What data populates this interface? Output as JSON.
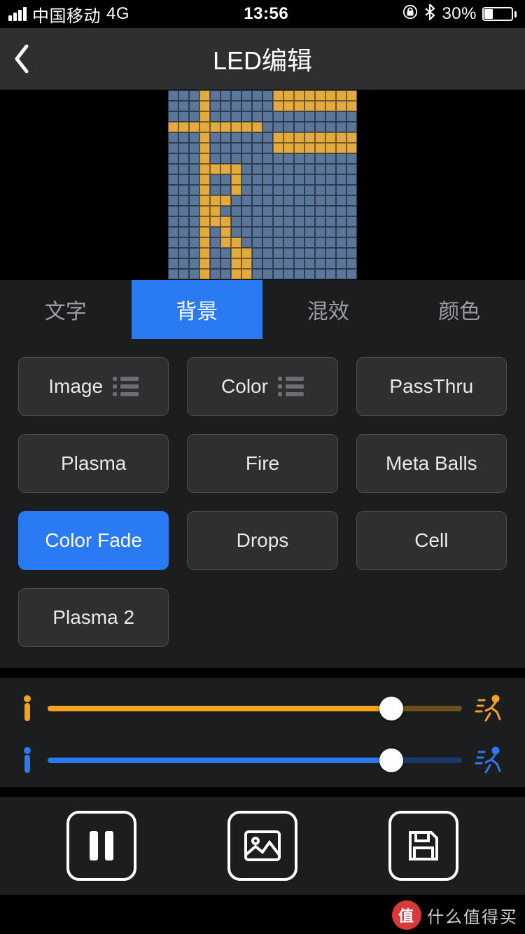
{
  "status": {
    "carrier": "中国移动",
    "network": "4G",
    "time": "13:56",
    "battery_pct": "30%",
    "lock_icon": "orientation-lock",
    "bluetooth_icon": "bluetooth"
  },
  "header": {
    "title": "LED编辑"
  },
  "tabs": [
    {
      "label": "文字",
      "active": false
    },
    {
      "label": "背景",
      "active": true
    },
    {
      "label": "混效",
      "active": false
    },
    {
      "label": "颜色",
      "active": false
    }
  ],
  "effects": [
    {
      "label": "Image",
      "has_list_icon": true,
      "selected": false
    },
    {
      "label": "Color",
      "has_list_icon": true,
      "selected": false
    },
    {
      "label": "PassThru",
      "has_list_icon": false,
      "selected": false
    },
    {
      "label": "Plasma",
      "has_list_icon": false,
      "selected": false
    },
    {
      "label": "Fire",
      "has_list_icon": false,
      "selected": false
    },
    {
      "label": "Meta Balls",
      "has_list_icon": false,
      "selected": false
    },
    {
      "label": "Color Fade",
      "has_list_icon": false,
      "selected": true
    },
    {
      "label": "Drops",
      "has_list_icon": false,
      "selected": false
    },
    {
      "label": "Cell",
      "has_list_icon": false,
      "selected": false
    },
    {
      "label": "Plasma 2",
      "has_list_icon": false,
      "selected": false
    }
  ],
  "sliders": {
    "speed": {
      "color": "#f4a320",
      "value_pct": 83
    },
    "intensity": {
      "color": "#2a7af4",
      "value_pct": 83
    }
  },
  "actions": {
    "pause": "pause",
    "gallery": "image-gallery",
    "save": "save"
  },
  "watermark": {
    "badge": "值",
    "text": "什么值得买"
  },
  "led_preview": {
    "cols": 18,
    "rows": 18,
    "on_cells": [
      "0,3",
      "1,3",
      "2,3",
      "3,3",
      "4,3",
      "5,3",
      "6,3",
      "7,3",
      "8,3",
      "9,3",
      "10,3",
      "11,3",
      "12,3",
      "13,3",
      "14,3",
      "15,3",
      "16,3",
      "17,3",
      "0,10",
      "0,11",
      "0,12",
      "0,13",
      "0,14",
      "0,15",
      "0,16",
      "0,17",
      "1,10",
      "1,11",
      "1,12",
      "1,13",
      "1,14",
      "1,15",
      "1,16",
      "1,17",
      "3,0",
      "3,1",
      "3,2",
      "3,3",
      "3,4",
      "3,5",
      "3,6",
      "3,7",
      "3,8",
      "4,10",
      "4,11",
      "4,12",
      "4,13",
      "4,14",
      "4,15",
      "4,16",
      "4,17",
      "5,10",
      "5,11",
      "5,12",
      "5,13",
      "5,14",
      "5,15",
      "5,16",
      "5,17",
      "7,3",
      "7,4",
      "7,5",
      "7,6",
      "8,6",
      "9,6",
      "10,5",
      "10,4",
      "11,4",
      "12,4",
      "12,5",
      "13,5",
      "14,5",
      "14,6",
      "15,6",
      "16,6",
      "17,6",
      "17,7",
      "16,7",
      "15,7",
      "17,3"
    ]
  }
}
